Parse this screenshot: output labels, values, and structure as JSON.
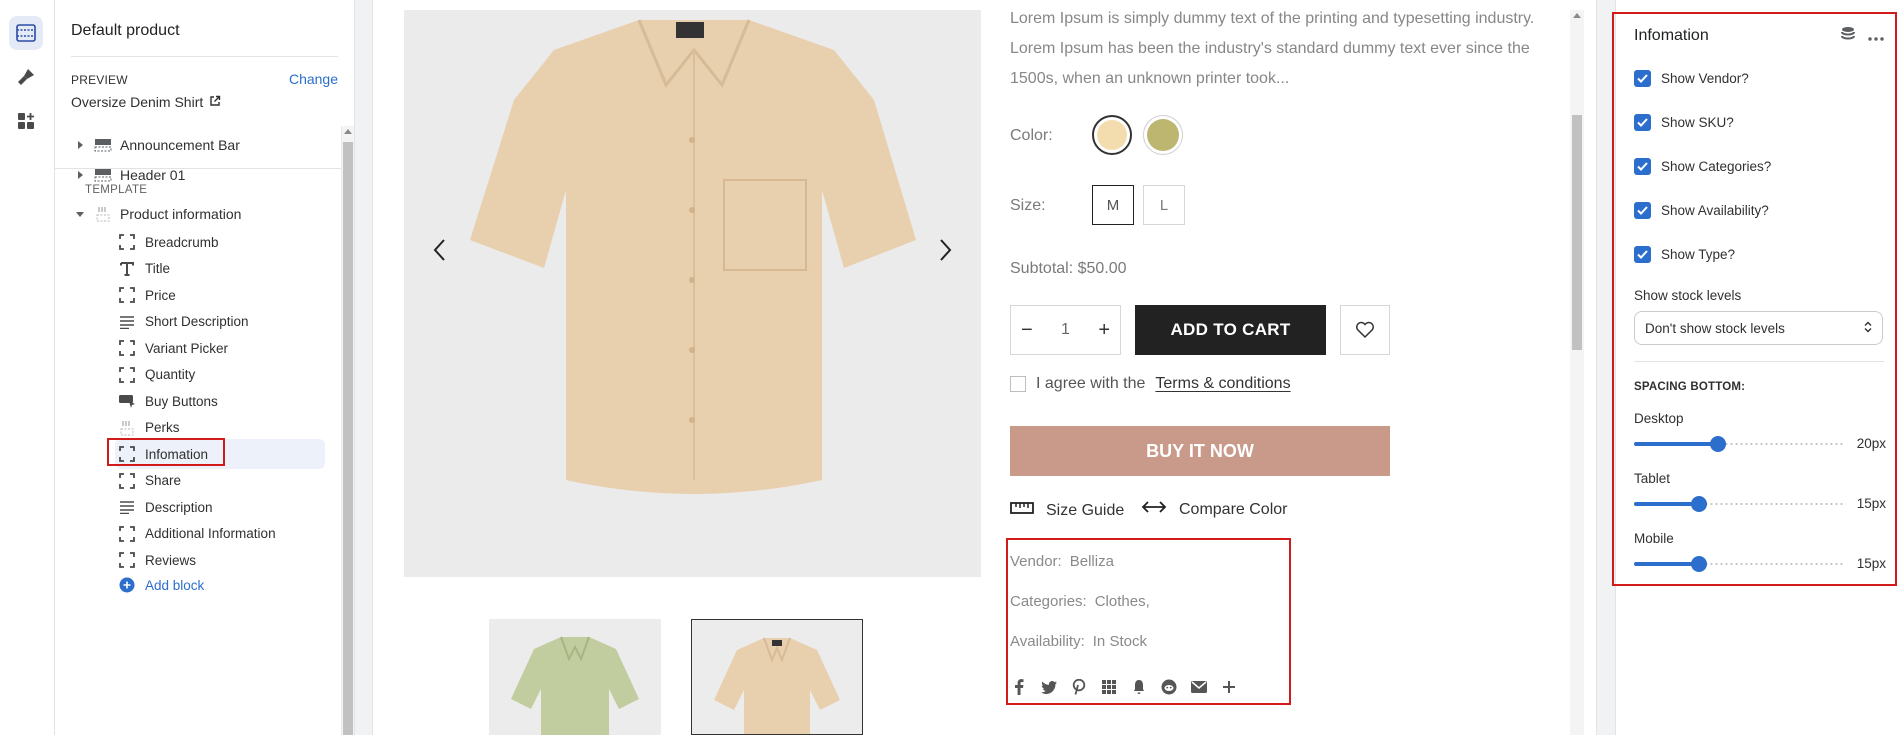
{
  "left_panel": {
    "title": "Default product",
    "preview_label": "PREVIEW",
    "change_label": "Change",
    "preview_value": "Oversize Denim Shirt",
    "sections": [
      {
        "label": "Announcement Bar"
      },
      {
        "label": "Header 01"
      }
    ],
    "template_label": "TEMPLATE",
    "template_section": "Product information",
    "blocks": [
      {
        "label": "Breadcrumb",
        "icon": "dashed-block-icon"
      },
      {
        "label": "Title",
        "icon": "text-icon"
      },
      {
        "label": "Price",
        "icon": "dashed-block-icon"
      },
      {
        "label": "Short Description",
        "icon": "lines-icon"
      },
      {
        "label": "Variant Picker",
        "icon": "dashed-block-icon"
      },
      {
        "label": "Quantity",
        "icon": "dashed-block-icon"
      },
      {
        "label": "Buy Buttons",
        "icon": "buy-buttons-icon"
      },
      {
        "label": "Perks",
        "icon": "perks-icon"
      },
      {
        "label": "Infomation",
        "icon": "dashed-block-icon"
      },
      {
        "label": "Share",
        "icon": "dashed-block-icon"
      },
      {
        "label": "Description",
        "icon": "lines-icon"
      },
      {
        "label": "Additional Information",
        "icon": "dashed-block-icon"
      },
      {
        "label": "Reviews",
        "icon": "dashed-block-icon"
      }
    ],
    "add_block_label": "Add block"
  },
  "product": {
    "description": "Lorem Ipsum is simply dummy text of the printing and typesetting industry. Lorem Ipsum has been the industry's standard dummy text ever since the 1500s, when an unknown printer took...",
    "color_label": "Color:",
    "colors": [
      "#f3dcae",
      "#bdb671"
    ],
    "size_label": "Size:",
    "sizes": [
      "M",
      "L"
    ],
    "subtotal": "Subtotal: $50.00",
    "quantity": "1",
    "add_to_cart": "ADD TO CART",
    "agree_text": "I agree with the",
    "terms": "Terms & conditions",
    "buy_now": "BUY IT NOW",
    "size_guide": "Size Guide",
    "compare_color": "Compare Color",
    "vendor_label": "Vendor:",
    "vendor": "Belliza",
    "categories_label": "Categories:",
    "categories": "Clothes,",
    "availability_label": "Availability:",
    "availability": "In Stock"
  },
  "right_panel": {
    "title": "Infomation",
    "checks": [
      {
        "label": "Show Vendor?"
      },
      {
        "label": "Show SKU?"
      },
      {
        "label": "Show Categories?"
      },
      {
        "label": "Show Availability?"
      },
      {
        "label": "Show Type?"
      }
    ],
    "stock_label": "Show stock levels",
    "stock_value": "Don't show stock levels",
    "spacing_label": "SPACING BOTTOM:",
    "sliders": [
      {
        "label": "Desktop",
        "value": "20px",
        "fraction": 0.4
      },
      {
        "label": "Tablet",
        "value": "15px",
        "fraction": 0.31
      },
      {
        "label": "Mobile",
        "value": "15px",
        "fraction": 0.31
      }
    ]
  },
  "colors": {
    "accent": "#2c6ecb",
    "highlight": "#d11a1a",
    "buy_now": "#c99a8a"
  }
}
